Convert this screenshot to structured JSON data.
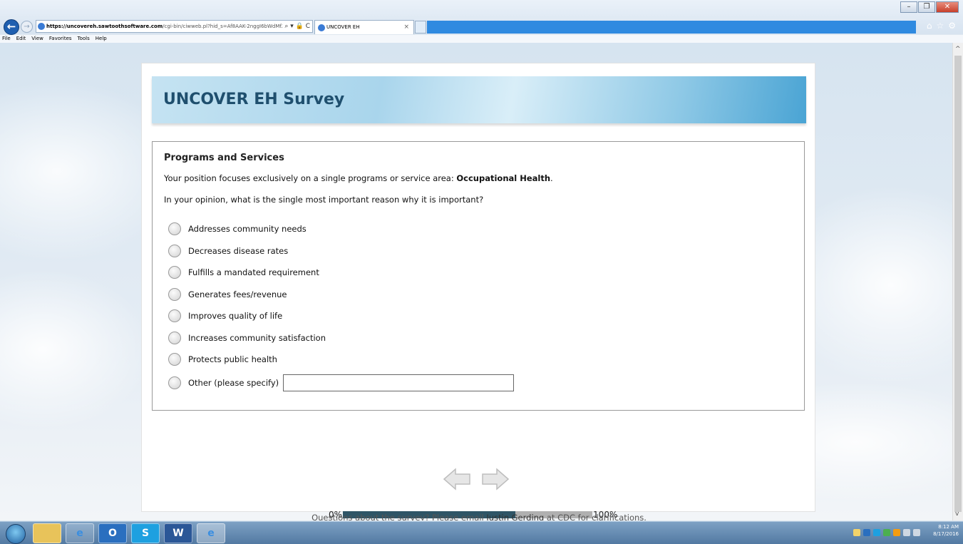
{
  "browser": {
    "url_host": "https://uncovereh.sawtoothsoftware.com",
    "url_path": "/cgi-bin/ciwweb.pl?hid_s=Af8AAK-2nggI6bWdMfZM",
    "url_tools": "⌕ ▾ 🔒 C",
    "tab_title": "UNCOVER EH",
    "tab_close": "×",
    "menu": [
      "File",
      "Edit",
      "View",
      "Favorites",
      "Tools",
      "Help"
    ],
    "win_minimize": "–",
    "win_restore": "❐",
    "win_close": "✕",
    "home": "⌂",
    "favorites_star": "☆",
    "settings": "⚙"
  },
  "survey": {
    "title": "UNCOVER EH Survey",
    "section_header": "Programs and Services",
    "intro_text": "Your position focuses exclusively on a single programs or service area: ",
    "intro_area": "Occupational Health",
    "intro_end": ".",
    "question": "In your opinion, what is the single most important reason why it is important?",
    "options": [
      "Addresses community needs",
      "Decreases disease rates",
      "Fulfills a mandated requirement",
      "Generates fees/revenue",
      "Improves quality of life",
      "Increases community satisfaction",
      "Protects public health",
      "Other (please specify)"
    ],
    "other_value": "",
    "progress_start": "0%",
    "progress_end": "100%",
    "progress_fraction": 0.69,
    "footer_pre": "Questions about the survey? Please email ",
    "footer_link": "Justin Gerding",
    "footer_post": " at CDC for clarifications."
  },
  "taskbar": {
    "time": "8:12 AM",
    "date": "8/17/2016",
    "apps": [
      "explorer",
      "internet-explorer",
      "outlook",
      "skype",
      "word",
      "internet-explorer"
    ]
  },
  "colors": {
    "banner_text": "#1f4f6e",
    "progress_fill": "#2f5566",
    "progress_track": "#b0b0b0",
    "tab_strip": "#2f8ae0"
  }
}
